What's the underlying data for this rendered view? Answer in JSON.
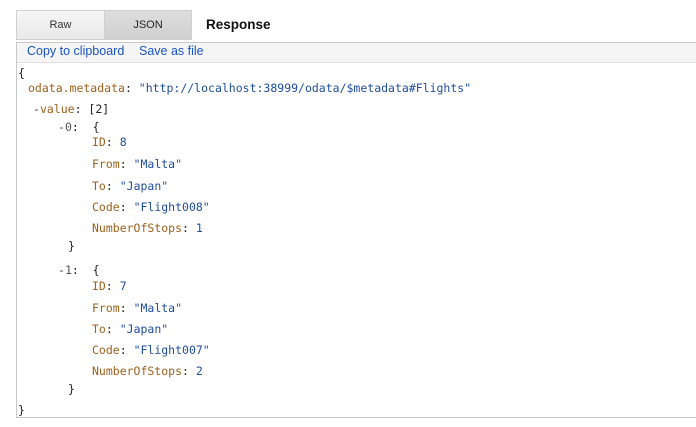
{
  "tabs": {
    "raw": "Raw",
    "json": "JSON",
    "active": "JSON"
  },
  "heading": "Response",
  "toolbar": {
    "copy": "Copy to clipboard",
    "save": "Save as file"
  },
  "json": {
    "open_brace": "{",
    "close_brace": "}",
    "metadata_key": "odata.metadata",
    "metadata_value": "\"http://localhost:38999/odata/$metadata#Flights\"",
    "value_toggle": "-",
    "value_key": "value",
    "value_count": "[2]",
    "items": [
      {
        "toggle": "-",
        "index": "0",
        "fields": [
          {
            "key": "ID",
            "value": "8"
          },
          {
            "key": "From",
            "value": "\"Malta\""
          },
          {
            "key": "To",
            "value": "\"Japan\""
          },
          {
            "key": "Code",
            "value": "\"Flight008\""
          },
          {
            "key": "NumberOfStops",
            "value": "1"
          }
        ]
      },
      {
        "toggle": "-",
        "index": "1",
        "fields": [
          {
            "key": "ID",
            "value": "7"
          },
          {
            "key": "From",
            "value": "\"Malta\""
          },
          {
            "key": "To",
            "value": "\"Japan\""
          },
          {
            "key": "Code",
            "value": "\"Flight007\""
          },
          {
            "key": "NumberOfStops",
            "value": "2"
          }
        ]
      }
    ]
  },
  "colors": {
    "key": "#a0601c",
    "value": "#1f4e9d",
    "link": "#1a55c4"
  }
}
